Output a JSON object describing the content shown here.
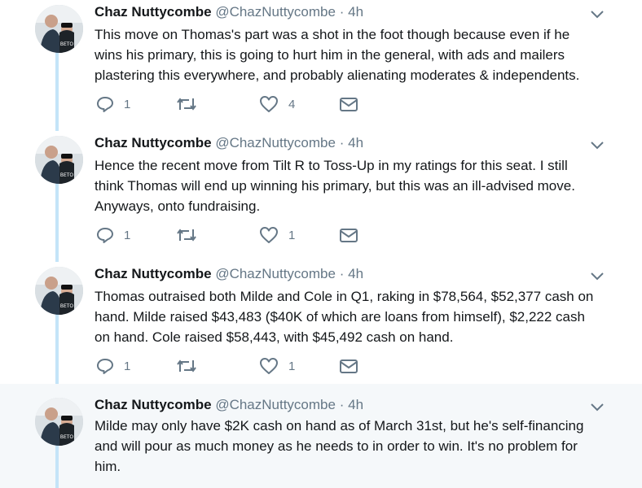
{
  "tweets": [
    {
      "name": "Chaz Nuttycombe",
      "handle": "@ChazNuttycombe",
      "sep": "·",
      "time": "4h",
      "lines": [
        "This move on Thomas's part was a shot in the foot though because even if he",
        "wins his primary, this is going to hurt him in the general, with ads and mailers",
        "plastering this everywhere, and probably alienating moderates & independents."
      ],
      "replies": "1",
      "retweets": "",
      "likes": "4"
    },
    {
      "name": "Chaz Nuttycombe",
      "handle": "@ChazNuttycombe",
      "sep": "·",
      "time": "4h",
      "lines": [
        "Hence the recent move from Tilt R to Toss-Up in my ratings for this seat. I still",
        "think Thomas will end up winning his primary, but this was an ill-advised move.",
        "Anyways, onto fundraising."
      ],
      "replies": "1",
      "retweets": "",
      "likes": "1"
    },
    {
      "name": "Chaz Nuttycombe",
      "handle": "@ChazNuttycombe",
      "sep": "·",
      "time": "4h",
      "lines": [
        "Thomas outraised both Milde and Cole in Q1, raking in $78,564, $52,377 cash on",
        "hand. Milde raised $43,483 ($40K of which are loans from himself), $2,222 cash",
        "on hand. Cole raised $58,443, with $45,492 cash on hand."
      ],
      "replies": "1",
      "retweets": "",
      "likes": "1"
    },
    {
      "name": "Chaz Nuttycombe",
      "handle": "@ChazNuttycombe",
      "sep": "·",
      "time": "4h",
      "lines": [
        "Milde may only have $2K cash on hand as of March 31st, but he's self-financing",
        "and will pour as much money as he needs to in order to win. It's no problem for",
        "him."
      ]
    }
  ],
  "avatar_badge": "BETO",
  "colors": {
    "thread_rail": "#c4e4f8",
    "highlight_bg": "#f5f8fa",
    "muted": "#657786"
  }
}
